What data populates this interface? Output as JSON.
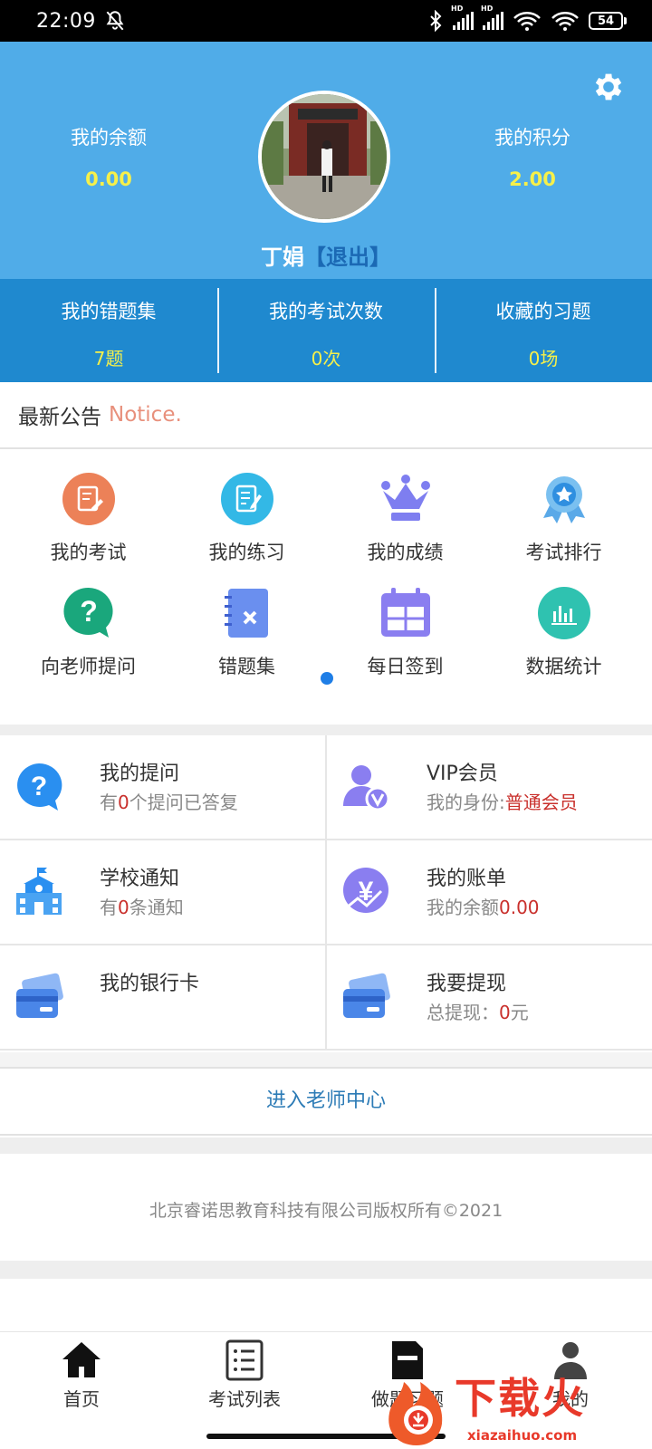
{
  "status_bar": {
    "time": "22:09",
    "battery": "54",
    "hd1": "HD",
    "hd2": "HD"
  },
  "header": {
    "balance_label": "我的余额",
    "balance_value": "0.00",
    "points_label": "我的积分",
    "points_value": "2.00",
    "username": "丁娟",
    "logout_label": "【退出】"
  },
  "stats": [
    {
      "label": "我的错题集",
      "value": "7题"
    },
    {
      "label": "我的考试次数",
      "value": "0次"
    },
    {
      "label": "收藏的习题",
      "value": "0场"
    }
  ],
  "notice": {
    "title": "最新公告",
    "subtitle": "Notice."
  },
  "grid": [
    {
      "label": "我的考试",
      "icon": "exam-icon"
    },
    {
      "label": "我的练习",
      "icon": "practice-icon"
    },
    {
      "label": "我的成绩",
      "icon": "crown-icon"
    },
    {
      "label": "考试排行",
      "icon": "ribbon-icon"
    },
    {
      "label": "向老师提问",
      "icon": "question-icon"
    },
    {
      "label": "错题集",
      "icon": "notebook-icon"
    },
    {
      "label": "每日签到",
      "icon": "calendar-icon"
    },
    {
      "label": "数据统计",
      "icon": "stats-icon"
    }
  ],
  "cards": {
    "questions": {
      "title": "我的提问",
      "sub_prefix": "有",
      "sub_value": "0",
      "sub_suffix": "个提问已答复"
    },
    "vip": {
      "title": "VIP会员",
      "sub_prefix": "我的身份:",
      "sub_value": "普通会员"
    },
    "school": {
      "title": "学校通知",
      "sub_prefix": "有",
      "sub_value": "0",
      "sub_suffix": "条通知"
    },
    "bill": {
      "title": "我的账单",
      "sub_prefix": "我的余额",
      "sub_value": "0.00"
    },
    "bankcard": {
      "title": "我的银行卡"
    },
    "withdraw": {
      "title": "我要提现",
      "sub_prefix": "总提现：",
      "sub_value": "0",
      "sub_suffix": "元"
    }
  },
  "teacher_center": "进入老师中心",
  "copyright": "北京睿诺思教育科技有限公司版权所有©2021",
  "nav": [
    {
      "label": "首页",
      "icon": "home-icon"
    },
    {
      "label": "考试列表",
      "icon": "list-icon"
    },
    {
      "label": "做题习题",
      "icon": "practice-icon"
    },
    {
      "label": "我的",
      "icon": "user-icon"
    }
  ],
  "watermark": {
    "text": "下载火",
    "url": "xiazaihuo.com"
  },
  "colors": {
    "header_blue": "#50ace8",
    "band_blue": "#1f89cf",
    "yellow_value": "#f6f04a",
    "red_value": "#c9302c"
  }
}
